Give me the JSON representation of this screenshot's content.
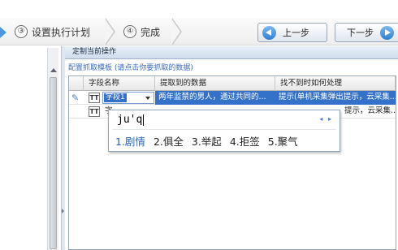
{
  "wizard": {
    "steps": [
      {
        "num": "③",
        "label": "设置执行计划"
      },
      {
        "num": "④",
        "label": "完成"
      }
    ],
    "prev_label": "上一步",
    "next_label": "下一步"
  },
  "panel": {
    "title": "定制当前操作",
    "config_hint": "配置抓取模板 (请点击你要抓取的数据)"
  },
  "grid": {
    "columns": [
      "字段名称",
      "提取到的数据",
      "找不到时如何处理"
    ],
    "rows": [
      {
        "type_badge": "TT",
        "field_name": "字段1",
        "extracted": "两年监禁的男人，通过共同的...",
        "on_missing": "提示(单机采集弹出提示，云采集..."
      },
      {
        "type_badge": "TT",
        "field_name": "字",
        "extracted": "",
        "on_missing": "提示，云采集..."
      }
    ]
  },
  "ime": {
    "composition": "ju'q",
    "page_arrows": "◂ ▸",
    "candidates": [
      "1.剧情",
      "2.俱全",
      "3.举起",
      "4.拒签",
      "5.聚气"
    ]
  },
  "colors": {
    "selection": "#3471c8",
    "accent": "#2f7fd3"
  }
}
